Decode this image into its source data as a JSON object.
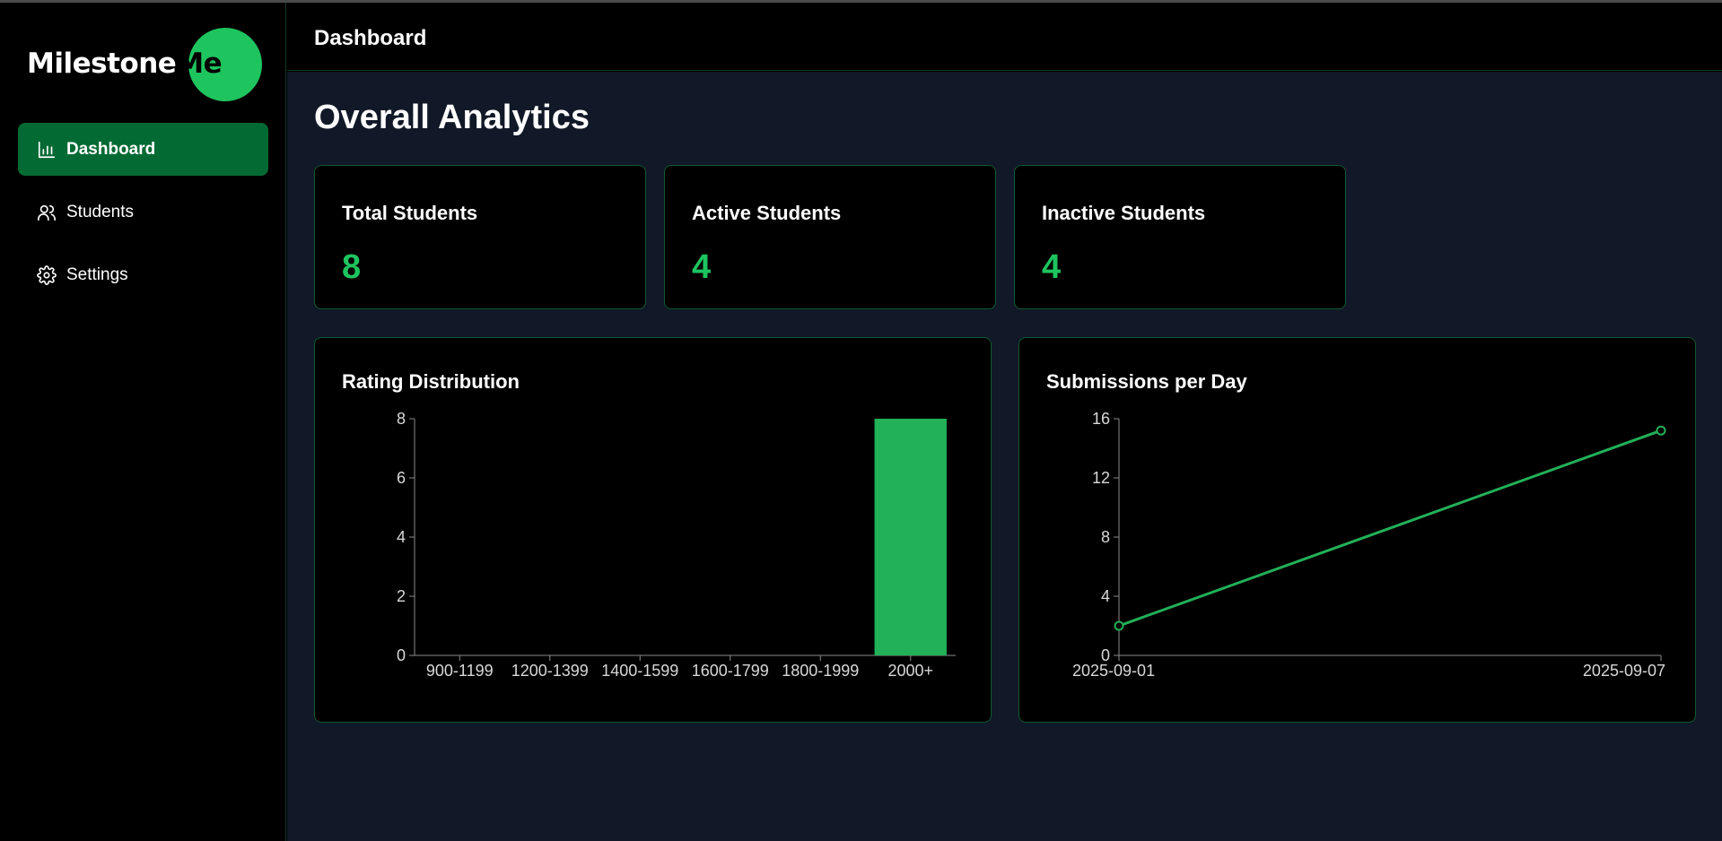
{
  "sidebar": {
    "logo": {
      "part1": "Milestone",
      "part2": "Me"
    },
    "items": [
      {
        "label": "Dashboard",
        "icon": "bar-chart-icon",
        "active": true
      },
      {
        "label": "Students",
        "icon": "users-icon",
        "active": false
      },
      {
        "label": "Settings",
        "icon": "gear-icon",
        "active": false
      }
    ]
  },
  "header": {
    "title": "Dashboard"
  },
  "main": {
    "title": "Overall Analytics",
    "stats": [
      {
        "label": "Total Students",
        "value": "8"
      },
      {
        "label": "Active Students",
        "value": "4"
      },
      {
        "label": "Inactive Students",
        "value": "4"
      }
    ]
  },
  "colors": {
    "accent": "#1ec45e",
    "active_nav": "#046a33",
    "bar": "#22b058",
    "main_bg": "#111827"
  },
  "chart_data": [
    {
      "type": "bar",
      "title": "Rating Distribution",
      "categories": [
        "900-1199",
        "1200-1399",
        "1400-1599",
        "1600-1799",
        "1800-1999",
        "2000+"
      ],
      "values": [
        0,
        0,
        0,
        0,
        0,
        8
      ],
      "ylim": [
        0,
        8
      ],
      "yticks": [
        0,
        2,
        4,
        6,
        8
      ],
      "grid": false
    },
    {
      "type": "line",
      "title": "Submissions per Day",
      "x": [
        "2025-09-01",
        "2025-09-07"
      ],
      "values": [
        2,
        15.2
      ],
      "ylim": [
        0,
        16
      ],
      "yticks": [
        0,
        4,
        8,
        12,
        16
      ],
      "grid": false
    }
  ]
}
